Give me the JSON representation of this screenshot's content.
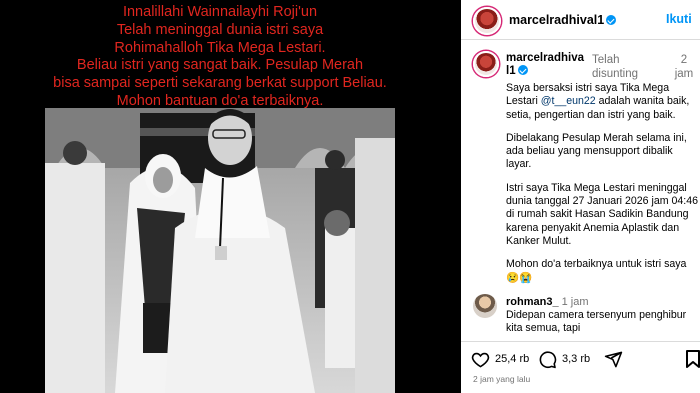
{
  "overlay": {
    "lines": [
      "Innalillahi Wainnailayhi Roji'un",
      "Telah meninggal dunia istri saya",
      "Rohimahalloh Tika Mega Lestari.",
      "Beliau istri yang sangat baik. Pesulap Merah",
      "bisa sampai seperti sekarang berkat support Beliau.",
      "Mohon bantuan do'a terbaiknya."
    ],
    "color": "#e0261f"
  },
  "header": {
    "username": "marcelradhival1",
    "follow_label": "Ikuti"
  },
  "caption": {
    "username": "marcelradhival1",
    "edited": "Telah disunting",
    "time": "2 jam",
    "p1_pre": "Saya bersaksi istri saya Tika Mega Lestari ",
    "p1_mention": "@t__eun22",
    "p1_post": " adalah wanita baik, setia, pengertian dan istri yang baik.",
    "p2": "Dibelakang Pesulap Merah selama ini, ada beliau yang mensupport dibalik layar.",
    "p3": "Istri saya Tika Mega Lestari meninggal dunia tanggal 27 Januari 2026 jam 04:46 di rumah sakit Hasan Sadikin Bandung karena penyakit Anemia Aplastik dan Kanker Mulut.",
    "p4": "Mohon do'a terbaiknya untuk istri saya",
    "p4_emoji": "😢😭"
  },
  "comment": {
    "username": "rohman3_",
    "time": "1 jam",
    "text": "Didepan camera tersenyum penghibur kita semua, tapi"
  },
  "actions": {
    "likes": "25,4 rb",
    "comments": "3,3 rb",
    "ago": "2 jam yang lalu"
  },
  "icons": [
    "verified-icon",
    "heart-icon",
    "comment-icon",
    "share-icon",
    "bookmark-icon"
  ],
  "colors": {
    "accent": "#0095f6",
    "overlay_text": "#e0261f"
  }
}
